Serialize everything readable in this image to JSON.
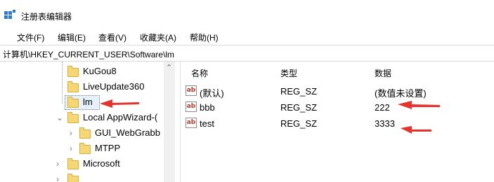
{
  "window": {
    "title": "注册表编辑器",
    "icon": "registry-editor-icon"
  },
  "menu": {
    "file": "文件(F)",
    "edit": "编辑(E)",
    "view": "查看(V)",
    "favorites": "收藏夹(A)",
    "help": "帮助(H)"
  },
  "address": {
    "path": "计算机\\HKEY_CURRENT_USER\\Software\\lm"
  },
  "tree": {
    "items": [
      {
        "label": "KuGou8"
      },
      {
        "label": "LiveUpdate360"
      },
      {
        "label": "lm"
      },
      {
        "label": "Local AppWizard-("
      },
      {
        "label": "GUI_WebGrabb"
      },
      {
        "label": "MTPP"
      },
      {
        "label": "Microsoft"
      }
    ]
  },
  "values": {
    "headers": {
      "name": "名称",
      "type": "类型",
      "data": "数据"
    },
    "rows": [
      {
        "name": "(默认)",
        "type": "REG_SZ",
        "data": "(数值未设置)"
      },
      {
        "name": "bbb",
        "type": "REG_SZ",
        "data": "222"
      },
      {
        "name": "test",
        "type": "REG_SZ",
        "data": "3333"
      }
    ]
  },
  "colors": {
    "annotation_arrow": "#e8322b",
    "selection": "#e5f1fb",
    "folder": "#f7d774"
  }
}
